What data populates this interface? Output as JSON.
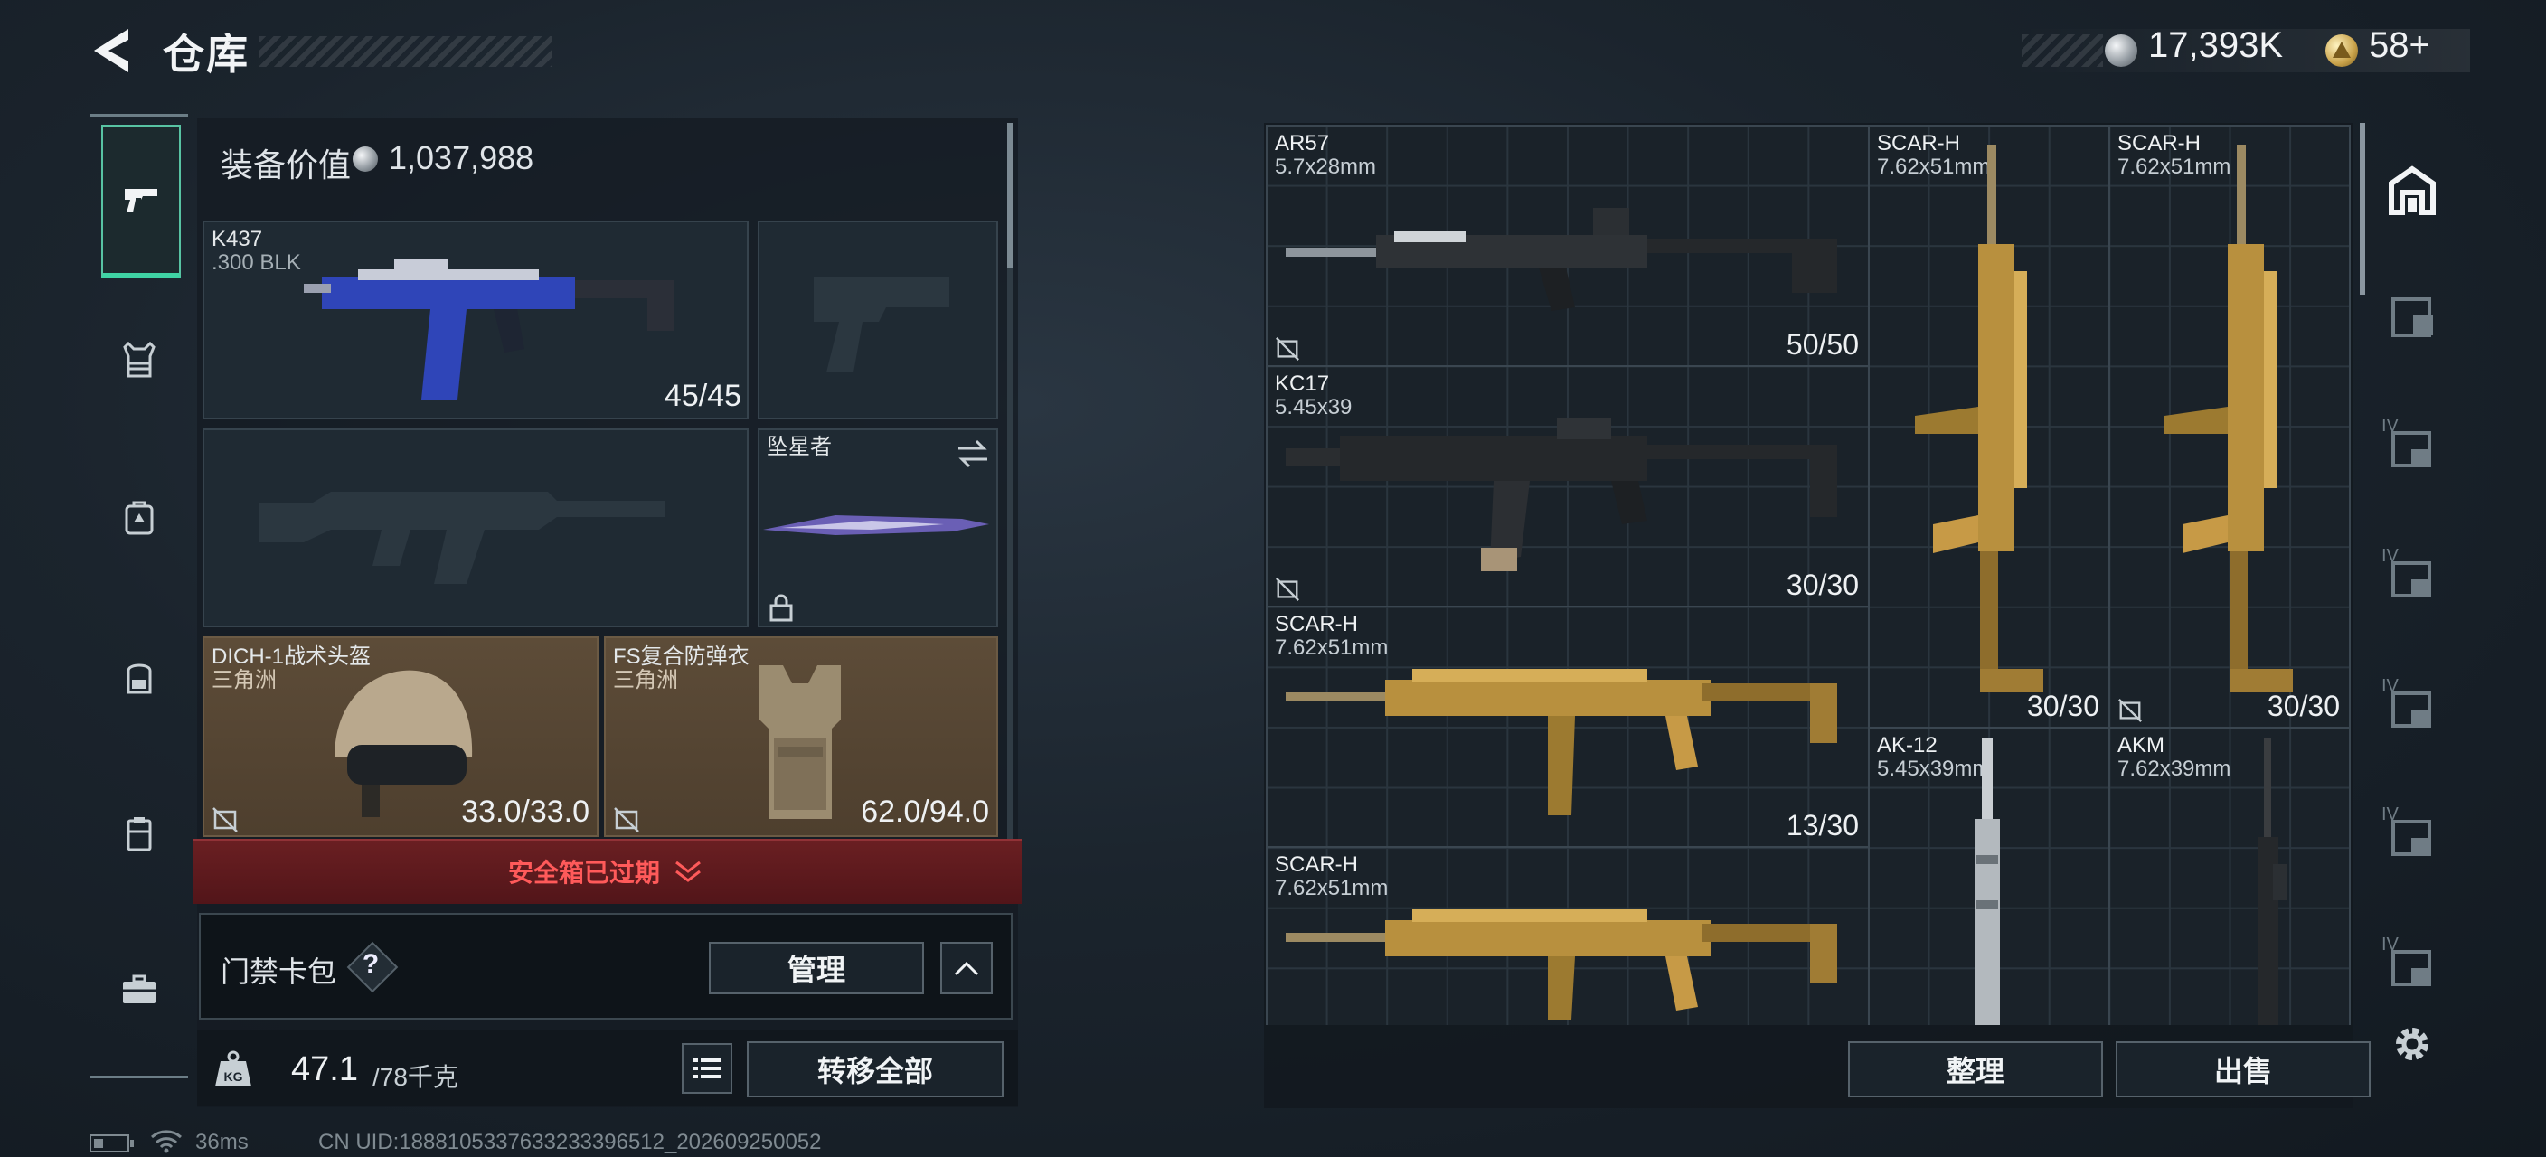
{
  "header": {
    "title": "仓库",
    "currency": [
      {
        "icon": "silver-coin-icon",
        "value": "17,393K"
      },
      {
        "icon": "gold-triangle-coin-icon",
        "value": "58+"
      }
    ]
  },
  "left_nav": {
    "items": [
      {
        "name": "firearm",
        "icon": "pistol-icon",
        "active": true
      },
      {
        "name": "vest",
        "icon": "vest-icon"
      },
      {
        "name": "backpack-pouch",
        "icon": "pack-icon"
      },
      {
        "name": "backpack",
        "icon": "backpack-icon"
      },
      {
        "name": "container",
        "icon": "container-icon"
      },
      {
        "name": "briefcase",
        "icon": "briefcase-icon"
      }
    ]
  },
  "equipment": {
    "value_label": "装备价值",
    "value": "1,037,988",
    "primary_weapon": {
      "name": "K437",
      "caliber": ".300 BLK",
      "ammo": "45/45"
    },
    "melee": {
      "name": "坠星者"
    },
    "helmet": {
      "name": "DICH-1战术头盔",
      "source": "三角洲",
      "durability": "33.0/33.0"
    },
    "armor": {
      "name": "FS复合防弹衣",
      "source": "三角洲",
      "durability": "62.0/94.0"
    },
    "safe_box_status": "安全箱已过期",
    "keycard": {
      "label": "门禁卡包",
      "help": "?",
      "manage_label": "管理"
    },
    "weight": {
      "current": "47.1",
      "max": "/78千克"
    },
    "transfer_all_label": "转移全部"
  },
  "stash": {
    "items": [
      {
        "name": "AR57",
        "caliber": "5.7x28mm",
        "ammo": "50/50",
        "skin": "dark"
      },
      {
        "name": "KC17",
        "caliber": "5.45x39",
        "ammo": "30/30",
        "skin": "dark"
      },
      {
        "name": "SCAR-H",
        "caliber": "7.62x51mm",
        "ammo": "13/30",
        "skin": "gold"
      },
      {
        "name": "SCAR-H",
        "caliber": "7.62x51mm",
        "ammo": "",
        "skin": "gold"
      },
      {
        "name": "SCAR-H",
        "caliber": "7.62x51mm",
        "ammo": "30/30",
        "skin": "gold"
      },
      {
        "name": "SCAR-H",
        "caliber": "7.62x51mm",
        "ammo": "30/30",
        "skin": "gold"
      },
      {
        "name": "AK-12",
        "caliber": "5.45x39mm",
        "ammo": "",
        "skin": "silver"
      },
      {
        "name": "AKM",
        "caliber": "7.62x39mm",
        "ammo": "",
        "skin": "dark"
      }
    ],
    "organize_label": "整理",
    "sell_label": "出售"
  },
  "side_tabs": {
    "labels": [
      "IV",
      "IV",
      "IV",
      "IV",
      "IV"
    ]
  },
  "status_bar": {
    "ping": "36ms",
    "uid": "CN UID:1888105337633233396512_202609250052"
  },
  "colors": {
    "accent_green": "#3fd3a4",
    "expired_red": "#ff5a5a",
    "gold": "#c9a24a"
  }
}
